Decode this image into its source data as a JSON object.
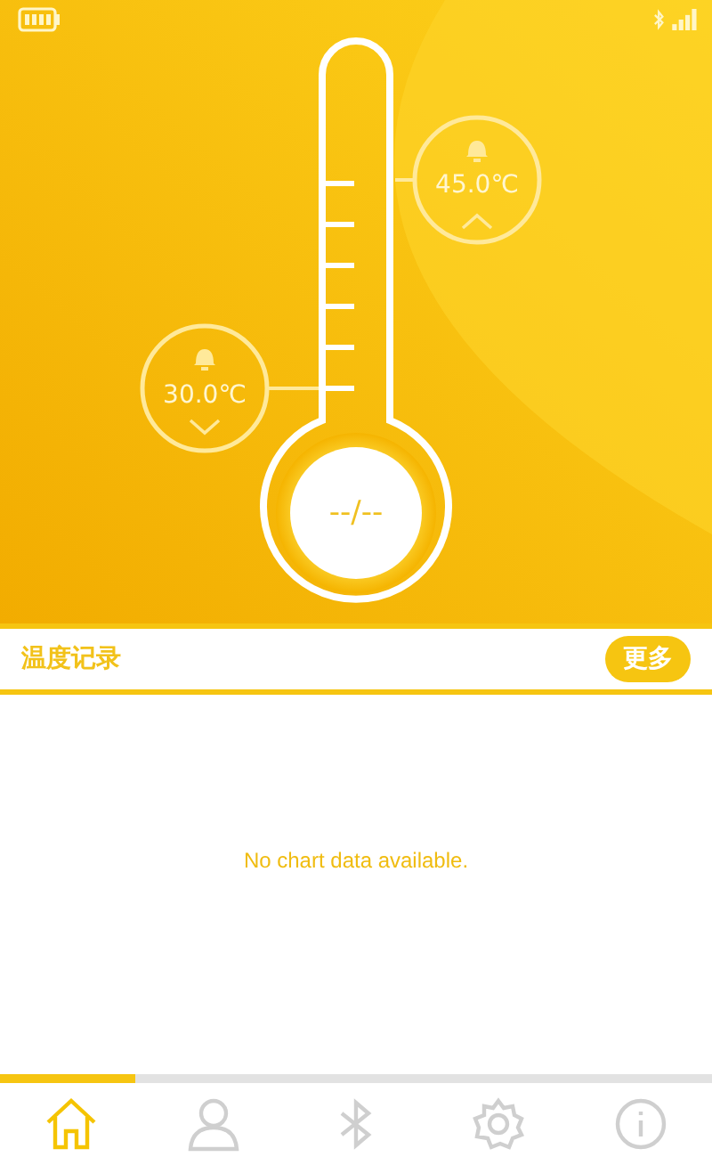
{
  "gauge": {
    "reading": "--/--",
    "high_alarm": {
      "value": "45.0℃"
    },
    "low_alarm": {
      "value": "30.0℃"
    }
  },
  "history": {
    "title": "温度记录",
    "more_button": "更多",
    "empty_message": "No chart data available."
  },
  "progress": {
    "level": 0.19
  },
  "tabs": [
    {
      "kind": "home",
      "selected": true
    },
    {
      "kind": "person",
      "selected": false
    },
    {
      "kind": "bluetooth",
      "selected": false
    },
    {
      "kind": "gear",
      "selected": false
    },
    {
      "kind": "info",
      "selected": false
    }
  ]
}
